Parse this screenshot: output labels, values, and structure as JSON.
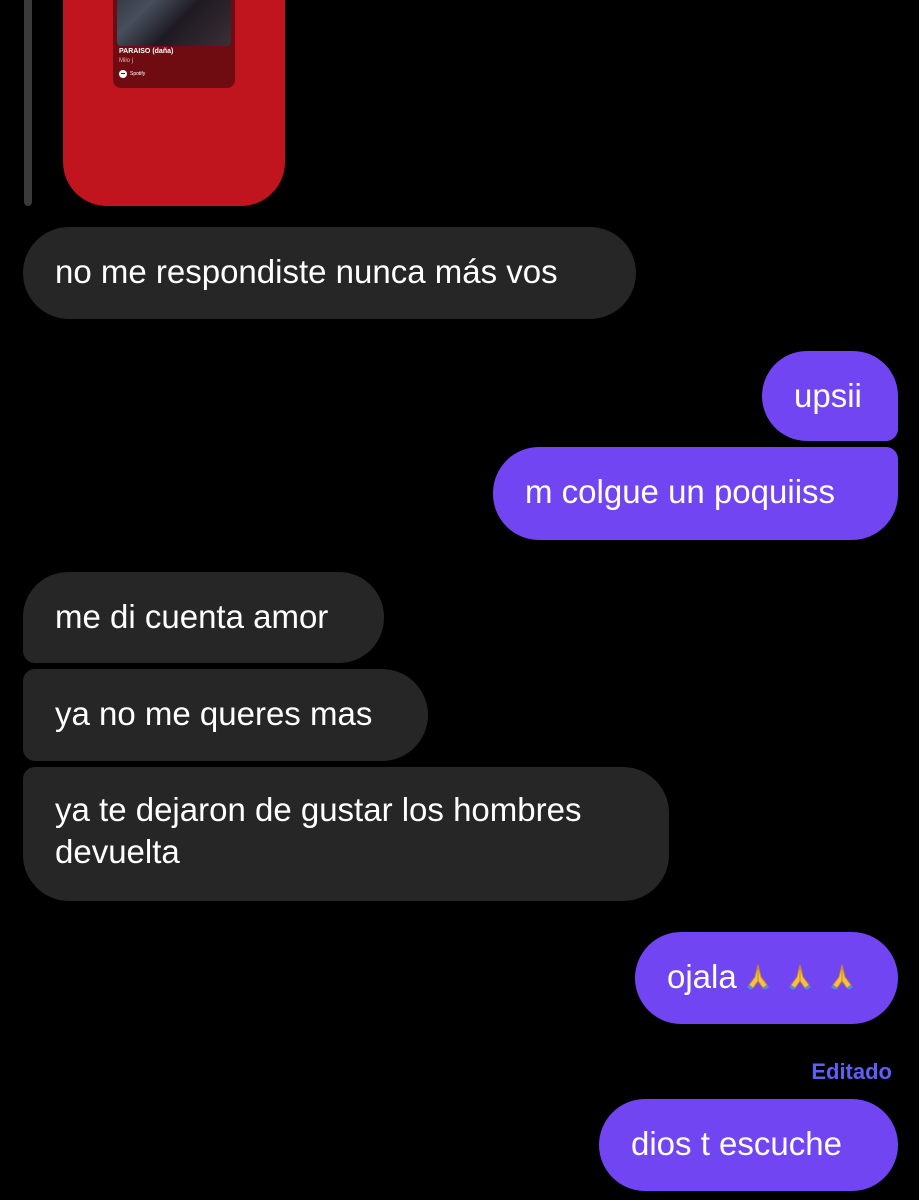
{
  "shared_song": {
    "title": "PARAISO (daña)",
    "artist": "Milo j",
    "source": "Spotify",
    "card_color": "#c0141f"
  },
  "messages": [
    {
      "id": "m1",
      "direction": "incoming",
      "text": "no me respondiste nunca más vos"
    },
    {
      "id": "m2",
      "direction": "outgoing",
      "text": "upsii"
    },
    {
      "id": "m3",
      "direction": "outgoing",
      "text": "m colgue un poquiiss"
    },
    {
      "id": "m4",
      "direction": "incoming",
      "text": "me di cuenta amor"
    },
    {
      "id": "m5",
      "direction": "incoming",
      "text": "ya no me queres mas"
    },
    {
      "id": "m6",
      "direction": "incoming",
      "text": "ya te dejaron de gustar los hombres devuelta"
    },
    {
      "id": "m7",
      "direction": "outgoing",
      "text": "ojala",
      "emoji": [
        "folded-hands",
        "folded-hands",
        "folded-hands"
      ]
    },
    {
      "id": "m8",
      "direction": "outgoing",
      "text": "dios t escuche",
      "edited_label": "Editado"
    }
  ],
  "colors": {
    "background": "#000000",
    "incoming_bubble": "#262626",
    "outgoing_bubble": "#7145f2",
    "edited_label": "#5f5ef5"
  }
}
